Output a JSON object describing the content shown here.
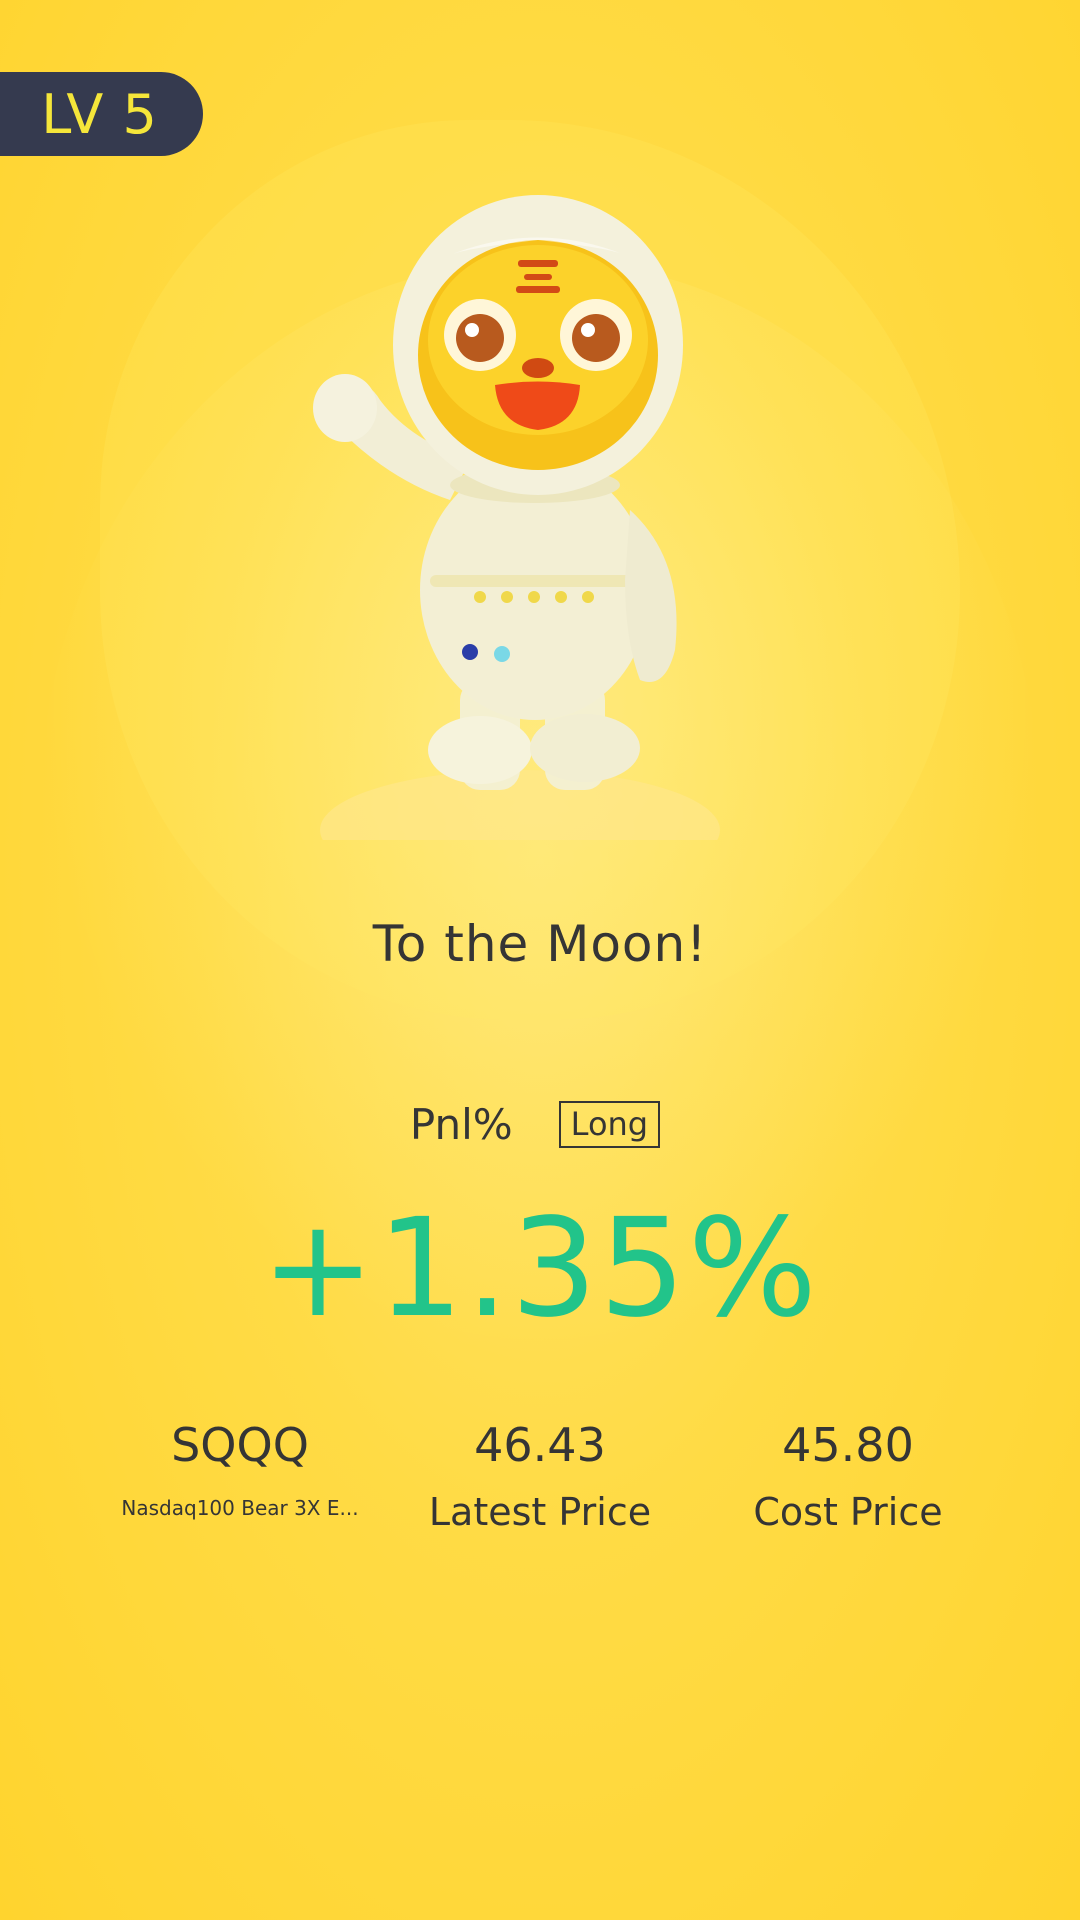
{
  "level_badge": {
    "text": "LV 5"
  },
  "mascot": {
    "icon": "astronaut-tiger-mascot"
  },
  "title": "To the Moon!",
  "pnl": {
    "label": "Pnl%",
    "direction": "Long",
    "value": "+1.35%",
    "color": "#22c48a"
  },
  "stats": {
    "symbol": "SQQQ",
    "symbol_name": "Nasdaq100 Bear 3X E...",
    "latest_price": "46.43",
    "latest_price_label": "Latest Price",
    "cost_price": "45.80",
    "cost_price_label": "Cost Price"
  },
  "colors": {
    "background": "#ffd830",
    "badge_bg": "#353a4f",
    "badge_text": "#f5e63a"
  }
}
